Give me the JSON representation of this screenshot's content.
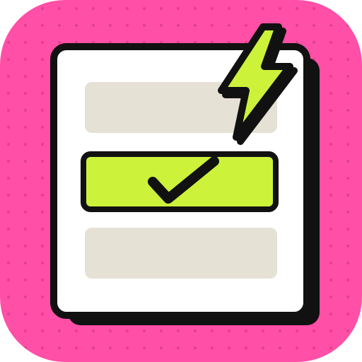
{
  "colors": {
    "background": "#ff4fa7",
    "background_dots": "#e0418e",
    "card": "#ffffff",
    "card_shadow": "#111111",
    "outline": "#111111",
    "placeholder_row": "#e6e1d5",
    "accent": "#ccf23a"
  },
  "icon": {
    "semantic_name": "checklist-app-icon",
    "rows": [
      {
        "name": "placeholder-row-top",
        "state": "empty"
      },
      {
        "name": "highlighted-row-checked",
        "state": "checked"
      },
      {
        "name": "placeholder-row-bottom",
        "state": "empty"
      }
    ],
    "badge": "lightning-bolt-icon"
  }
}
